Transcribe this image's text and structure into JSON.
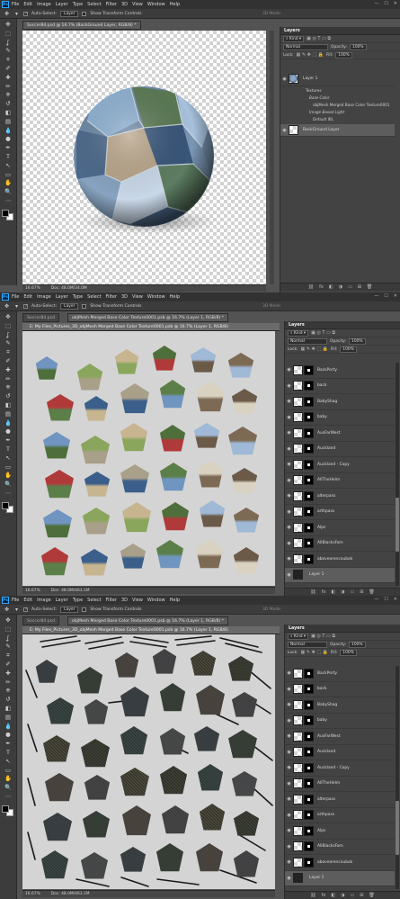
{
  "app": {
    "logo": "Ps",
    "menus": [
      "File",
      "Edit",
      "Image",
      "Layer",
      "Type",
      "Select",
      "Filter",
      "3D",
      "View",
      "Window",
      "Help"
    ],
    "window_controls": [
      "—",
      "☐",
      "✕"
    ]
  },
  "options_bar": {
    "auto_select_label": "Auto-Select:",
    "auto_select_target": "Layer",
    "show_transform_label": "Show Transform Controls",
    "mode_3d": "3D Mode:"
  },
  "tools": [
    "move-icon",
    "marquee-icon",
    "lasso-icon",
    "quick-select-icon",
    "crop-icon",
    "eyedropper-icon",
    "healing-icon",
    "brush-icon",
    "stamp-icon",
    "history-brush-icon",
    "eraser-icon",
    "gradient-icon",
    "blur-icon",
    "dodge-icon",
    "pen-icon",
    "type-icon",
    "path-select-icon",
    "shape-icon",
    "hand-icon",
    "zoom-icon",
    "more-icon"
  ],
  "tool_glyphs": [
    "✥",
    "⬚",
    "ʆ",
    "✎",
    "⌗",
    "✐",
    "✚",
    "✏",
    "⎈",
    "↺",
    "◧",
    "▤",
    "💧",
    "●",
    "✒",
    "T",
    "↖",
    "▭",
    "✋",
    "🔍",
    "⋯"
  ],
  "screens": [
    {
      "doc_tab": "Soccer84.psd @ 16.7% (BackGround Layer, RGB/8) *",
      "status_zoom": "16.67%",
      "status_doc": "Doc: 48.0M/34.0M",
      "layers_panel": {
        "tab": "Layers",
        "kind": "Kind",
        "blend": "Normal",
        "opacity_label": "Opacity:",
        "opacity": "100%",
        "lock_label": "Lock:",
        "fill_label": "Fill:",
        "fill": "100%",
        "layer_name": "Layer 1",
        "textures": "Textures",
        "base_color": "Base Color",
        "texture_name": "objMesh Merged Base Color Texture0001",
        "ibl": "Image Based Light",
        "ibl_name": "Default IBL",
        "bg_layer": "BackGround Layer"
      }
    },
    {
      "doc_tab": "Soccer84.psd",
      "doc_tab2": "objMesh Merged Base Color Texture0001.psb @ 16.7% (Layer 1, RGB/8) *",
      "doc_title": "E: My Files_Pictures_3D_objMesh Merged Base Color Texture0001.psb @ 16.7% (Layer 1, RGB/8)",
      "status_zoom": "16.67%",
      "status_doc": "Doc: 48.0M/463.1M",
      "layers_panel": {
        "tab": "Layers",
        "kind": "Kind",
        "blend": "Normal",
        "opacity_label": "Opacity:",
        "opacity": "100%",
        "lock_label": "Lock:",
        "fill_label": "Fill:",
        "fill": "100%",
        "layers": [
          "BackPorty",
          "back",
          "BabyShag",
          "baby",
          "AusFarWest",
          "Auckland",
          "Auckland - Copy",
          "AllTheHelm",
          "alterpass",
          "arthpass",
          "Alps",
          "AllBlacksFam",
          "aboveorencoubak",
          "Layer 1"
        ]
      }
    },
    {
      "doc_tab": "Soccer84.psd",
      "doc_tab2": "objMesh Merged Base Color Texture0001.psb @ 16.7% (Layer 1, RGB/8) *",
      "doc_title": "E: My Files_Pictures_3D_objMesh Merged Base Color Texture0001.psb @ 16.7% (Layer 1, RGB/8)",
      "status_zoom": "16.67%",
      "status_doc": "Doc: 48.0M/463.1M",
      "layers_panel": {
        "tab": "Layers",
        "kind": "Kind",
        "blend": "Normal",
        "opacity_label": "Opacity:",
        "opacity": "100%",
        "lock_label": "Lock:",
        "fill_label": "Fill:",
        "fill": "100%",
        "layers": [
          "BackPorty",
          "back",
          "BabyShag",
          "baby",
          "AusFarWest",
          "Auckland",
          "Auckland - Copy",
          "AllTheHelm",
          "alterpass",
          "arthpass",
          "Alps",
          "AllBlacksFam",
          "aboveorencoubak",
          "Layer 1"
        ]
      }
    }
  ],
  "colors": {
    "ui_dark": "#323232",
    "panel": "#434343",
    "workspace": "#535353",
    "selected_layer": "#5d5d5d"
  }
}
